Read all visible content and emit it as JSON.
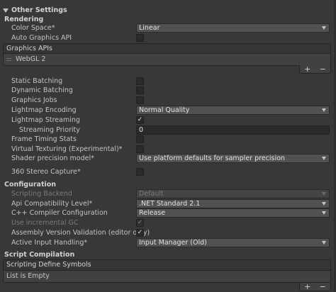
{
  "section_title": "Other Settings",
  "rendering": {
    "header": "Rendering",
    "color_space_label": "Color Space*",
    "color_space_value": "Linear",
    "auto_graphics_api_label": "Auto Graphics API",
    "auto_graphics_api_checked": false,
    "graphics_apis_header": "Graphics APIs",
    "graphics_apis_items": [
      "WebGL 2"
    ],
    "add_symbol": "+",
    "remove_symbol": "−",
    "static_batching_label": "Static Batching",
    "dynamic_batching_label": "Dynamic Batching",
    "graphics_jobs_label": "Graphics Jobs",
    "lightmap_encoding_label": "Lightmap Encoding",
    "lightmap_encoding_value": "Normal Quality",
    "lightmap_streaming_label": "Lightmap Streaming",
    "lightmap_streaming_checked": true,
    "streaming_priority_label": "Streaming Priority",
    "streaming_priority_value": "0",
    "frame_timing_stats_label": "Frame Timing Stats",
    "virtual_texturing_label": "Virtual Texturing (Experimental)*",
    "shader_precision_label": "Shader precision model*",
    "shader_precision_value": "Use platform defaults for sampler precision",
    "stereo_capture_label": "360 Stereo Capture*"
  },
  "configuration": {
    "header": "Configuration",
    "scripting_backend_label": "Scripting Backend",
    "scripting_backend_value": "Default",
    "api_compat_label": "Api Compatibility Level*",
    "api_compat_value": ".NET Standard 2.1",
    "cpp_compiler_label": "C++ Compiler Configuration",
    "cpp_compiler_value": "Release",
    "incremental_gc_label": "Use incremental GC",
    "incremental_gc_checked": true,
    "assembly_validation_label": "Assembly Version Validation (editor only)",
    "assembly_validation_checked": true,
    "active_input_label": "Active Input Handling*",
    "active_input_value": "Input Manager (Old)"
  },
  "script_compilation": {
    "header": "Script Compilation",
    "define_symbols_header": "Scripting Define Symbols",
    "define_symbols_empty": "List is Empty"
  },
  "check_glyph": "✓",
  "colors": {
    "background": "#383838",
    "text": "#c4c4c4",
    "disabled_text": "#7a7a7a",
    "dropdown_bg": "#515151",
    "field_bg": "#2a2a2a"
  }
}
